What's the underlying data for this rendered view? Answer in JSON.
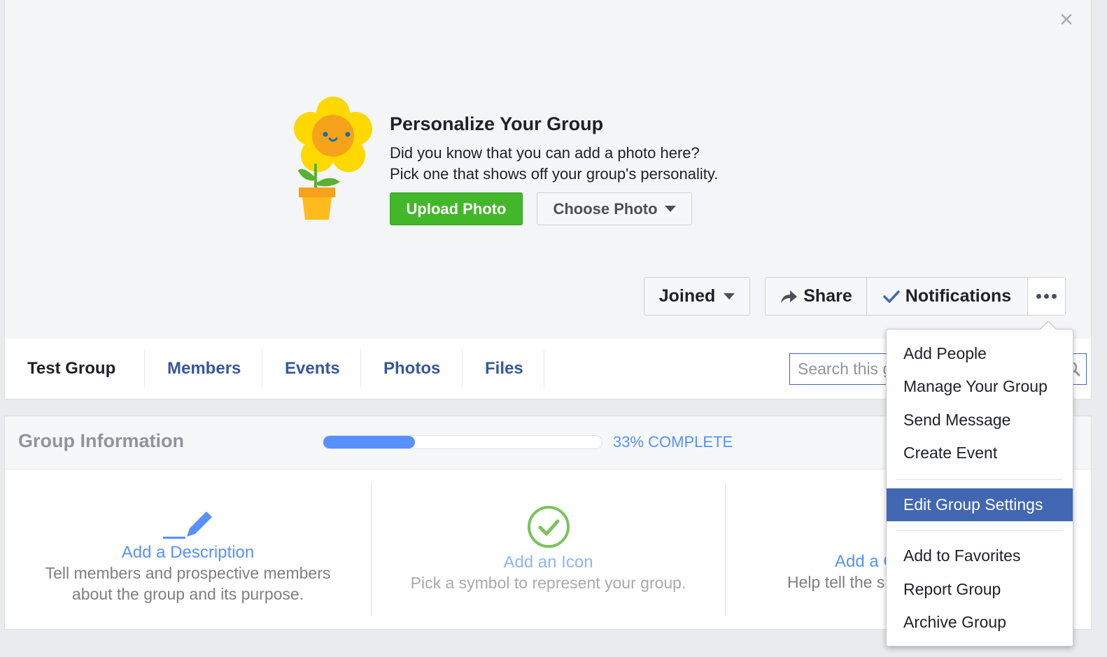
{
  "cover": {
    "close_label": "×",
    "title": "Personalize Your Group",
    "line1": "Did you know that you can add a photo here?",
    "line2": "Pick one that shows off your group's personality.",
    "upload_label": "Upload Photo",
    "choose_label": "Choose Photo"
  },
  "actions": {
    "joined_label": "Joined",
    "share_label": "Share",
    "notifications_label": "Notifications"
  },
  "nav": {
    "group_name": "Test Group",
    "tabs": [
      {
        "label": "Members"
      },
      {
        "label": "Events"
      },
      {
        "label": "Photos"
      },
      {
        "label": "Files"
      }
    ],
    "search_placeholder": "Search this group"
  },
  "group_info": {
    "title": "Group Information",
    "progress_fraction": 0.33,
    "progress_text": "33% COMPLETE",
    "cards": [
      {
        "link": "Add a Description",
        "desc_line1": "Tell members and prospective members",
        "desc_line2": "about the group and its purpose."
      },
      {
        "link": "Add an Icon",
        "desc_line1": "Pick a symbol to represent your group."
      },
      {
        "link": "Add a C",
        "desc_line1": "Help tell the s"
      }
    ]
  },
  "menu": {
    "items": [
      {
        "label": "Add People"
      },
      {
        "label": "Manage Your Group"
      },
      {
        "label": "Send Message"
      },
      {
        "label": "Create Event"
      },
      {
        "label": "Edit Group Settings"
      },
      {
        "label": "Add to Favorites"
      },
      {
        "label": "Report Group"
      },
      {
        "label": "Archive Group"
      }
    ]
  },
  "colors": {
    "upload_green": "#42b72a",
    "link_blue": "#365899",
    "progress_blue": "#5890ff",
    "menu_highlight": "#4267b2"
  }
}
